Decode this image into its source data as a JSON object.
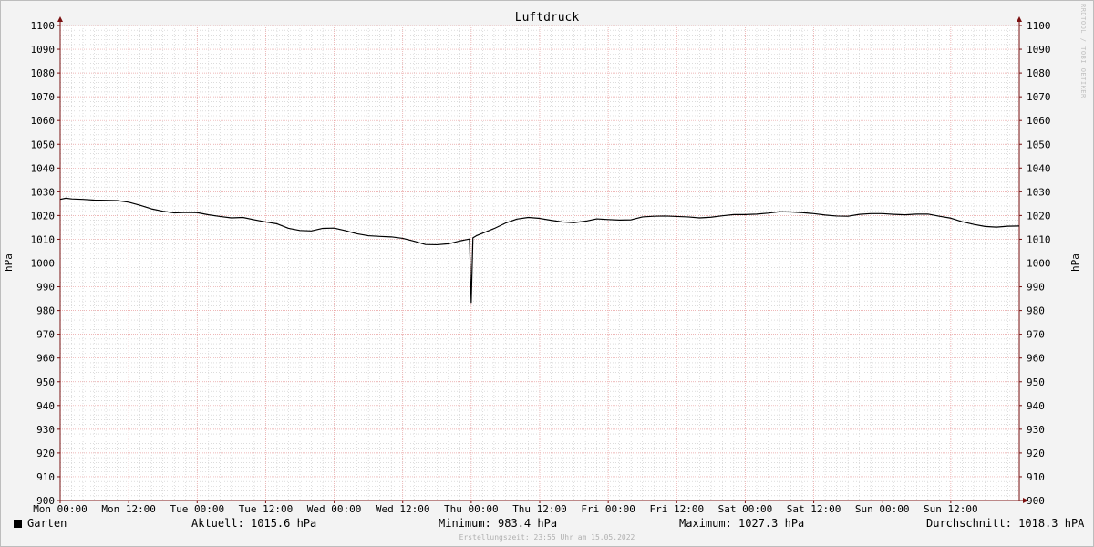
{
  "chart_data": {
    "type": "line",
    "title": "Luftdruck",
    "ylabel": "hPa",
    "ylabel_right": "hPa",
    "ylim": [
      900,
      1100
    ],
    "y_ticks": [
      900,
      910,
      920,
      930,
      940,
      950,
      960,
      970,
      980,
      990,
      1000,
      1010,
      1020,
      1030,
      1040,
      1050,
      1060,
      1070,
      1080,
      1090,
      1100
    ],
    "x_unit": "hours since Mon 00:00",
    "xlim": [
      0,
      168
    ],
    "x_ticks": [
      {
        "x": 0,
        "label": "Mon 00:00"
      },
      {
        "x": 12,
        "label": "Mon 12:00"
      },
      {
        "x": 24,
        "label": "Tue 00:00"
      },
      {
        "x": 36,
        "label": "Tue 12:00"
      },
      {
        "x": 48,
        "label": "Wed 00:00"
      },
      {
        "x": 60,
        "label": "Wed 12:00"
      },
      {
        "x": 72,
        "label": "Thu 00:00"
      },
      {
        "x": 84,
        "label": "Thu 12:00"
      },
      {
        "x": 96,
        "label": "Fri 00:00"
      },
      {
        "x": 108,
        "label": "Fri 12:00"
      },
      {
        "x": 120,
        "label": "Sat 00:00"
      },
      {
        "x": 132,
        "label": "Sat 12:00"
      },
      {
        "x": 144,
        "label": "Sun 00:00"
      },
      {
        "x": 156,
        "label": "Sun 12:00"
      }
    ],
    "grid": true,
    "legend_placement": "bottom-left",
    "series": [
      {
        "name": "Garten",
        "color": "#000000",
        "points": [
          [
            0,
            1026.8
          ],
          [
            1,
            1027.3
          ],
          [
            2,
            1027.0
          ],
          [
            4,
            1026.8
          ],
          [
            6,
            1026.5
          ],
          [
            8,
            1026.4
          ],
          [
            10,
            1026.3
          ],
          [
            12,
            1025.6
          ],
          [
            14,
            1024.3
          ],
          [
            16,
            1022.8
          ],
          [
            18,
            1021.8
          ],
          [
            20,
            1021.1
          ],
          [
            22,
            1021.3
          ],
          [
            24,
            1021.2
          ],
          [
            26,
            1020.3
          ],
          [
            28,
            1019.6
          ],
          [
            30,
            1019.0
          ],
          [
            32,
            1019.2
          ],
          [
            34,
            1018.2
          ],
          [
            36,
            1017.3
          ],
          [
            38,
            1016.5
          ],
          [
            40,
            1014.6
          ],
          [
            42,
            1013.7
          ],
          [
            44,
            1013.5
          ],
          [
            46,
            1014.6
          ],
          [
            48,
            1014.7
          ],
          [
            50,
            1013.6
          ],
          [
            52,
            1012.3
          ],
          [
            54,
            1011.5
          ],
          [
            56,
            1011.2
          ],
          [
            58,
            1011.0
          ],
          [
            60,
            1010.4
          ],
          [
            62,
            1009.2
          ],
          [
            64,
            1007.8
          ],
          [
            66,
            1007.7
          ],
          [
            68,
            1008.1
          ],
          [
            70,
            1009.3
          ],
          [
            71.7,
            1010.1
          ],
          [
            72.0,
            983.4
          ],
          [
            72.3,
            1010.6
          ],
          [
            73,
            1011.6
          ],
          [
            76,
            1014.5
          ],
          [
            78,
            1016.8
          ],
          [
            80,
            1018.5
          ],
          [
            82,
            1019.2
          ],
          [
            84,
            1018.8
          ],
          [
            86,
            1018.0
          ],
          [
            88,
            1017.3
          ],
          [
            90,
            1017.0
          ],
          [
            92,
            1017.6
          ],
          [
            94,
            1018.6
          ],
          [
            96,
            1018.3
          ],
          [
            98,
            1018.1
          ],
          [
            100,
            1018.2
          ],
          [
            102,
            1019.4
          ],
          [
            104,
            1019.7
          ],
          [
            106,
            1019.8
          ],
          [
            108,
            1019.6
          ],
          [
            110,
            1019.4
          ],
          [
            112,
            1019.0
          ],
          [
            114,
            1019.3
          ],
          [
            116,
            1019.9
          ],
          [
            118,
            1020.4
          ],
          [
            120,
            1020.4
          ],
          [
            122,
            1020.6
          ],
          [
            124,
            1021.0
          ],
          [
            126,
            1021.6
          ],
          [
            128,
            1021.5
          ],
          [
            130,
            1021.2
          ],
          [
            132,
            1020.8
          ],
          [
            134,
            1020.2
          ],
          [
            136,
            1019.8
          ],
          [
            138,
            1019.7
          ],
          [
            140,
            1020.5
          ],
          [
            142,
            1020.8
          ],
          [
            144,
            1020.8
          ],
          [
            146,
            1020.5
          ],
          [
            148,
            1020.3
          ],
          [
            150,
            1020.6
          ],
          [
            152,
            1020.6
          ],
          [
            154,
            1019.7
          ],
          [
            156,
            1018.9
          ],
          [
            158,
            1017.4
          ],
          [
            160,
            1016.3
          ],
          [
            162,
            1015.4
          ],
          [
            164,
            1015.1
          ],
          [
            166,
            1015.5
          ],
          [
            168,
            1015.6
          ]
        ]
      }
    ]
  },
  "legend": {
    "series_name": "Garten",
    "current": "Aktuell: 1015.6 hPa",
    "minimum": "Minimum: 983.4 hPa",
    "maximum": "Maximum: 1027.3 hPa",
    "average": "Durchschnitt: 1018.3 hPA"
  },
  "footer": {
    "created": "Erstellungszeit: 23:55 Uhr am 15.05.2022",
    "watermark": "RRDTOOL / TOBI OETIKER"
  },
  "colors": {
    "background": "#f3f3f3",
    "plot_background": "#ffffff",
    "major_grid": "#e8a0a0",
    "minor_grid": "#c8c8c8",
    "axis": "#7a1010",
    "line": "#000000"
  }
}
